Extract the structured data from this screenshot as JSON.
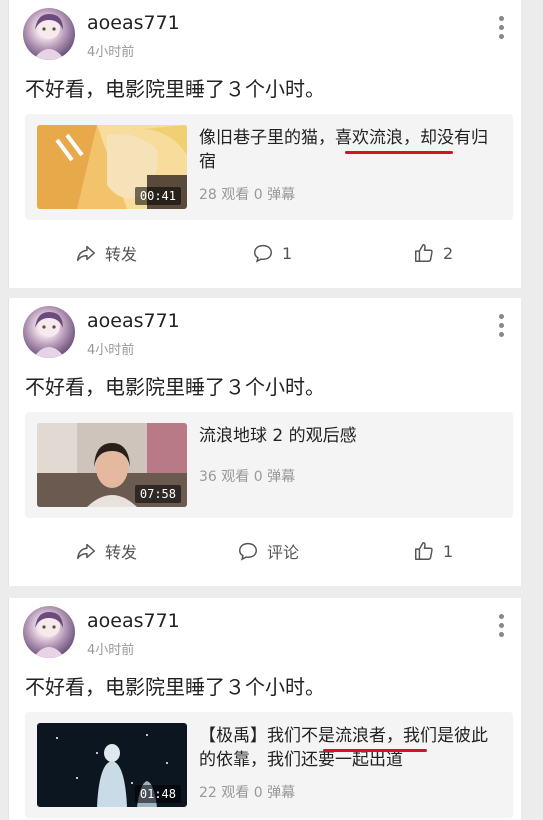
{
  "posts": [
    {
      "username": "aoeas771",
      "time": "4小时前",
      "content": "不好看，电影院里睡了３个小时。",
      "card": {
        "title": "像旧巷子里的猫，喜欢流浪，却没有归宿",
        "duration": "00:41",
        "meta": "28 观看 0 弹幕"
      },
      "actions": {
        "share": "转发",
        "comment": "1",
        "like": "2"
      }
    },
    {
      "username": "aoeas771",
      "time": "4小时前",
      "content": "不好看，电影院里睡了３个小时。",
      "card": {
        "title": "流浪地球 2 的观后感",
        "duration": "07:58",
        "meta": "36 观看 0 弹幕"
      },
      "actions": {
        "share": "转发",
        "comment": "评论",
        "like": "1"
      }
    },
    {
      "username": "aoeas771",
      "time": "4小时前",
      "content": "不好看，电影院里睡了３个小时。",
      "card": {
        "title": "【极禹】我们不是流浪者，我们是彼此的依靠，我们还要一起出道",
        "duration": "01:48",
        "meta": "22 观看 0 弹幕"
      }
    }
  ],
  "icons": {
    "share": "share-arrow-icon",
    "comment": "comment-bubble-icon",
    "like": "thumbs-up-icon",
    "more": "more-vertical-icon"
  },
  "colors": {
    "highlight_underline": "#d6102b",
    "text": "#222222",
    "muted": "#999999",
    "card_bg": "#f4f4f4"
  }
}
